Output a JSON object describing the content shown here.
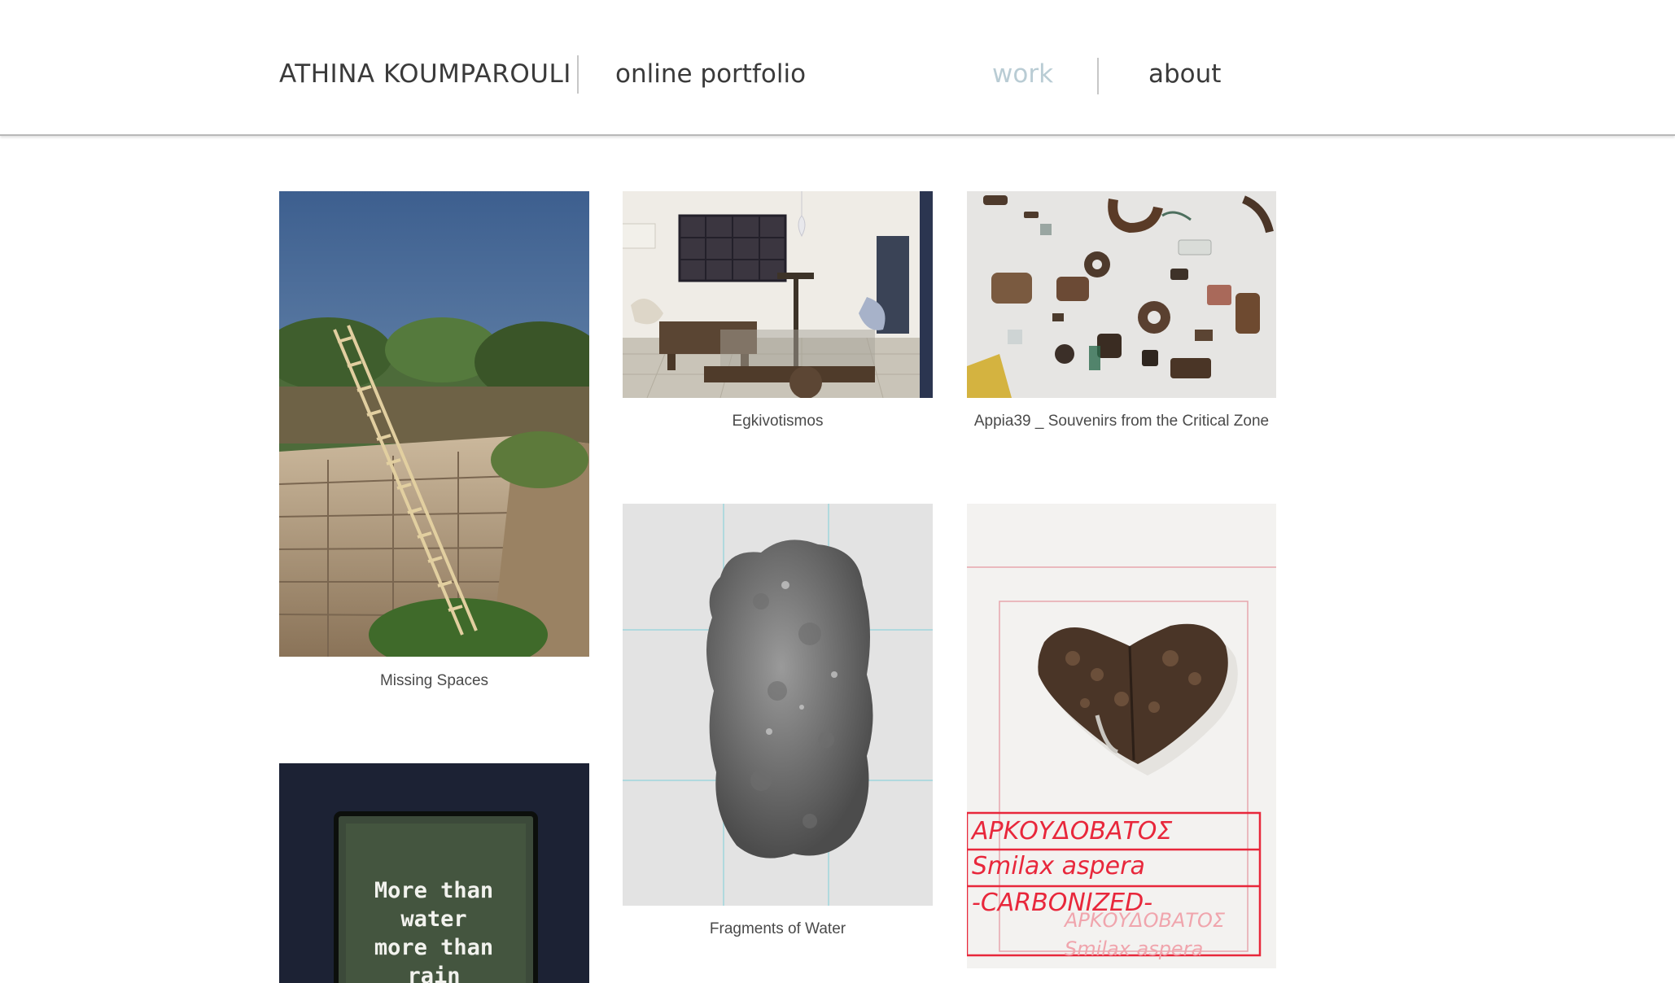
{
  "header": {
    "site_name": "ATHINA KOUMPAROULI",
    "tagline": "online portfolio",
    "nav": [
      {
        "label": "work",
        "active": true
      },
      {
        "label": "about",
        "active": false
      }
    ],
    "colors": {
      "active_nav": "#b9ccd4",
      "text": "#3a3a3a"
    }
  },
  "gallery": {
    "items": [
      {
        "title": "Missing Spaces",
        "image": "ladder-ruins-photo"
      },
      {
        "title": "Egkivotismos",
        "image": "studio-installation-photo"
      },
      {
        "title": "Appia39 _ Souvenirs from the Critical Zone",
        "image": "found-objects-photo"
      },
      {
        "title": "Fragments of Water",
        "image": "stone-fragment-photo"
      },
      {
        "title": "",
        "image": "carbonized-leaf-photo",
        "handwritten_labels": [
          "ΑΡΚΟΥΔΟΒΑΤΟΣ",
          "Smilax aspera",
          "-CARBONIZED-"
        ]
      },
      {
        "title": "",
        "image": "text-screen-photo",
        "screen_text": [
          "More than",
          "water",
          "more than",
          "rain"
        ]
      }
    ]
  }
}
